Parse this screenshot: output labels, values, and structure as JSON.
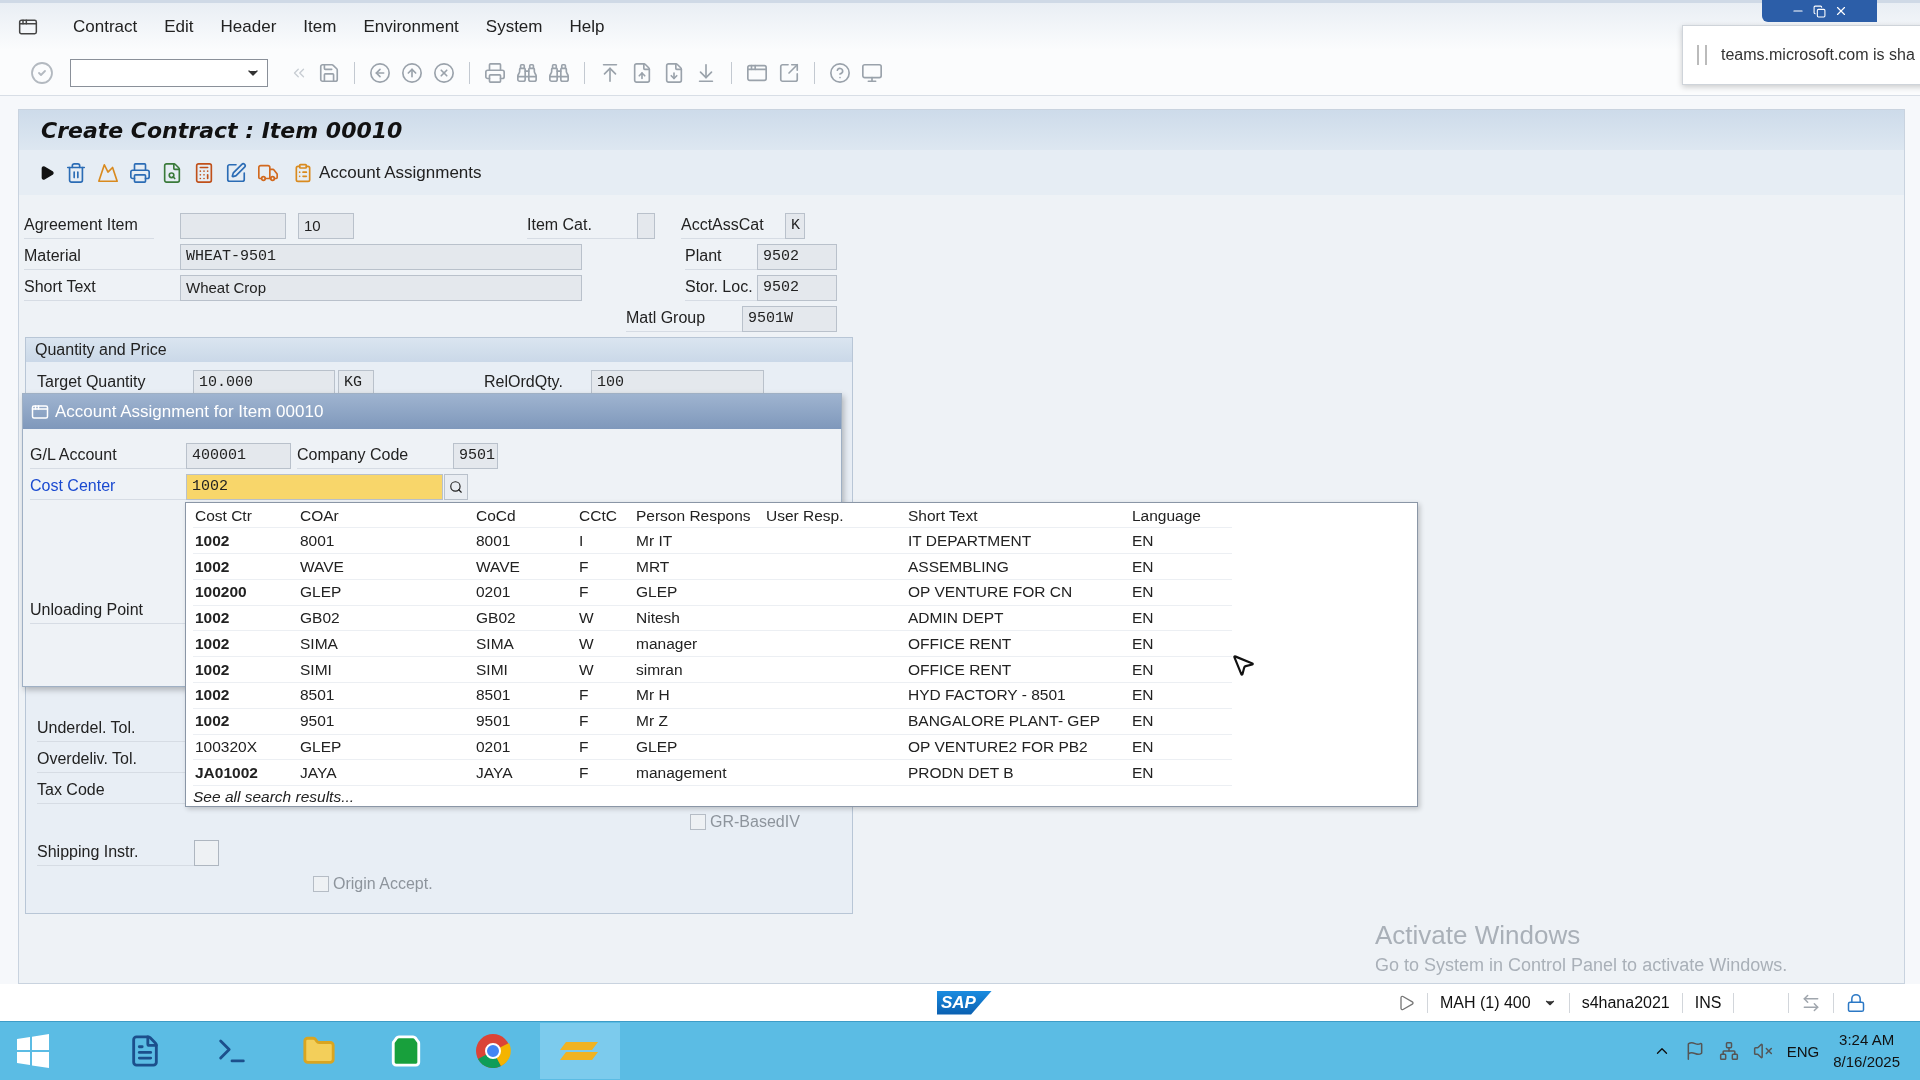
{
  "menu": [
    {
      "label": "Contract"
    },
    {
      "label": "Edit"
    },
    {
      "label": "Header"
    },
    {
      "label": "Item"
    },
    {
      "label": "Environment"
    },
    {
      "label": "System"
    },
    {
      "label": "Help"
    }
  ],
  "title": "Create Contract : Item 00010",
  "app_toolbar": {
    "button": "Account Assignments"
  },
  "header_fields": {
    "agreement_item": {
      "label": "Agreement Item",
      "value": "10"
    },
    "item_cat": {
      "label": "Item Cat."
    },
    "acct_ass_cat": {
      "label": "AcctAssCat",
      "value": "K"
    },
    "material": {
      "label": "Material",
      "value": "WHEAT-9501"
    },
    "plant": {
      "label": "Plant",
      "value": "9502"
    },
    "short_text": {
      "label": "Short Text",
      "value": "Wheat Crop"
    },
    "stor_loc": {
      "label": "Stor. Loc.",
      "value": "9502"
    },
    "matl_group": {
      "label": "Matl Group",
      "value": "9501W"
    }
  },
  "quantity_group": {
    "title": "Quantity and Price",
    "target_quantity": {
      "label": "Target Quantity",
      "value": "10.000",
      "unit": "KG"
    },
    "rel_ord_qty": {
      "label": "RelOrdQty.",
      "value": "100"
    }
  },
  "control_group": {
    "fields": [
      {
        "label": "Underdel. Tol."
      },
      {
        "label": "Overdeliv. Tol."
      },
      {
        "label": "Tax Code"
      }
    ],
    "gr_based_iv": {
      "label": "GR-BasedIV",
      "checked": false,
      "disabled": true
    },
    "shipping_instr": {
      "label": "Shipping Instr."
    },
    "origin_accept": {
      "label": "Origin Accept.",
      "checked": false,
      "disabled": true
    }
  },
  "popup": {
    "title": "Account Assignment for Item 00010",
    "gl_account": {
      "label": "G/L Account",
      "value": "400001"
    },
    "company_code": {
      "label": "Company Code",
      "value": "9501"
    },
    "cost_center": {
      "label": "Cost Center",
      "value": "1002"
    },
    "unloading_point": {
      "label": "Unloading Point"
    }
  },
  "search_help": {
    "columns": [
      "Cost Ctr",
      "COAr",
      "CoCd",
      "CCtC",
      "Person Respons",
      "User Resp.",
      "Short Text",
      "Language"
    ],
    "rows": [
      {
        "emphasized": true,
        "cells": [
          "1002",
          "8001",
          "8001",
          "I",
          "Mr IT",
          "",
          "IT DEPARTMENT",
          "EN"
        ]
      },
      {
        "emphasized": true,
        "cells": [
          "1002",
          "WAVE",
          "WAVE",
          "F",
          "MRT",
          "",
          "ASSEMBLING",
          "EN"
        ]
      },
      {
        "emphasized": true,
        "cells": [
          "100200",
          "GLEP",
          "0201",
          "F",
          "GLEP",
          "",
          "OP VENTURE FOR CN",
          "EN"
        ]
      },
      {
        "emphasized": true,
        "cells": [
          "1002",
          "GB02",
          "GB02",
          "W",
          "Nitesh",
          "",
          "ADMIN DEPT",
          "EN"
        ]
      },
      {
        "emphasized": true,
        "cells": [
          "1002",
          "SIMA",
          "SIMA",
          "W",
          "manager",
          "",
          "OFFICE RENT",
          "EN"
        ]
      },
      {
        "emphasized": true,
        "cells": [
          "1002",
          "SIMI",
          "SIMI",
          "W",
          "simran",
          "",
          "OFFICE RENT",
          "EN"
        ]
      },
      {
        "emphasized": true,
        "cells": [
          "1002",
          "8501",
          "8501",
          "F",
          "Mr H",
          "",
          "HYD FACTORY - 8501",
          "EN"
        ]
      },
      {
        "emphasized": true,
        "cells": [
          "1002",
          "9501",
          "9501",
          "F",
          "Mr Z",
          "",
          "BANGALORE PLANT- GEP",
          "EN"
        ]
      },
      {
        "emphasized": false,
        "cells": [
          "100320X",
          "GLEP",
          "0201",
          "F",
          "GLEP",
          "",
          "OP VENTURE2 FOR PB2",
          "EN"
        ]
      },
      {
        "emphasized": true,
        "cells": [
          "JA01002",
          "JAYA",
          "JAYA",
          "F",
          "management",
          "",
          "PRODN DET B",
          "EN"
        ]
      }
    ],
    "footer": "See all search results..."
  },
  "os_notice": {
    "title": "Activate Windows",
    "text": "Go to System in Control Panel to activate Windows."
  },
  "notification": {
    "text": "teams.microsoft.com is sha"
  },
  "status_bar": {
    "logo": "SAP",
    "system": "MAH (1) 400",
    "server": "s4hana2021",
    "mode": "INS"
  },
  "taskbar": {
    "language": "ENG",
    "time": "3:24 AM",
    "date": "8/16/2025"
  }
}
